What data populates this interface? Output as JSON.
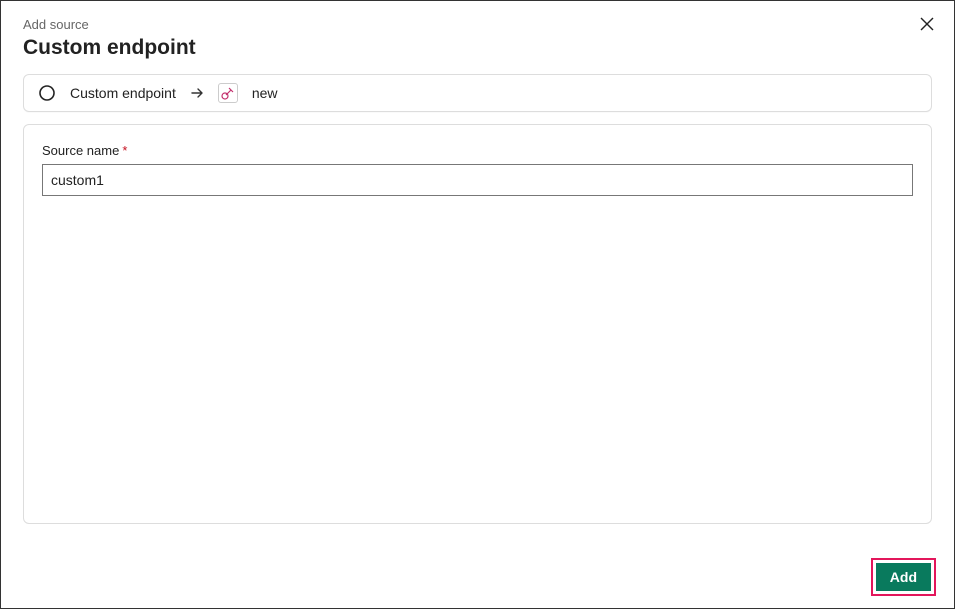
{
  "header": {
    "context_label": "Add source",
    "title": "Custom endpoint"
  },
  "breadcrumb": {
    "step1_label": "Custom endpoint",
    "step2_label": "new"
  },
  "form": {
    "source_name_label": "Source name",
    "required_mark": "*",
    "source_name_value": "custom1"
  },
  "footer": {
    "add_button": "Add"
  }
}
